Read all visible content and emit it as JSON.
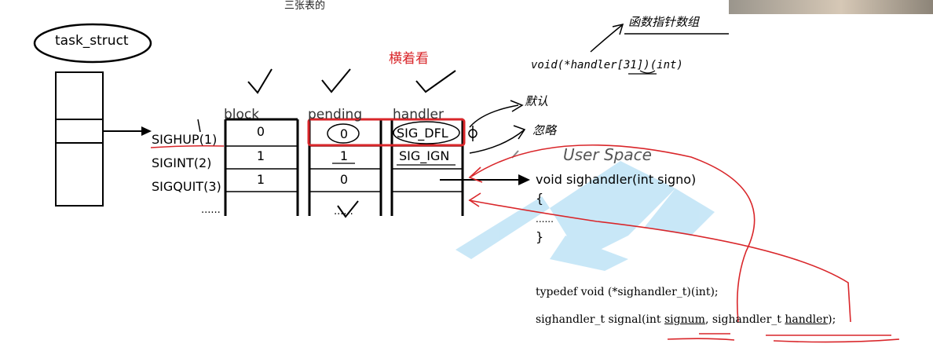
{
  "top_caption": "三张表的",
  "task_label": "task_struct",
  "note_horizontal": "横着看",
  "columns": {
    "block": "block",
    "pending": "pending",
    "handler": "handler"
  },
  "signals": [
    "SIGHUP(1)",
    "SIGINT(2)",
    "SIGQUIT(3)"
  ],
  "ellipsis": "......",
  "block_values": [
    "0",
    "1",
    "1"
  ],
  "pending_values": [
    "0",
    "1",
    "0"
  ],
  "handler_values": [
    "SIG_DFL",
    "SIG_IGN",
    ""
  ],
  "annotations": {
    "default": "默认",
    "ignore": "忽略",
    "func_ptr_array": "函数指针数组"
  },
  "handler_array_decl": "void(*handler[31])(int)",
  "user_space": {
    "title": "User Space",
    "func_sig": "void sighandler(int signo)",
    "open_brace": "{",
    "body": "......",
    "close_brace": "}"
  },
  "code": {
    "typedef_line": "typedef void (*sighandler_t)(int);",
    "signal_line_prefix": "sighandler_t signal(int ",
    "signal_param1": "signum",
    "signal_middle": ", sighandler_t ",
    "signal_param2": "handler",
    "signal_suffix": ");"
  }
}
